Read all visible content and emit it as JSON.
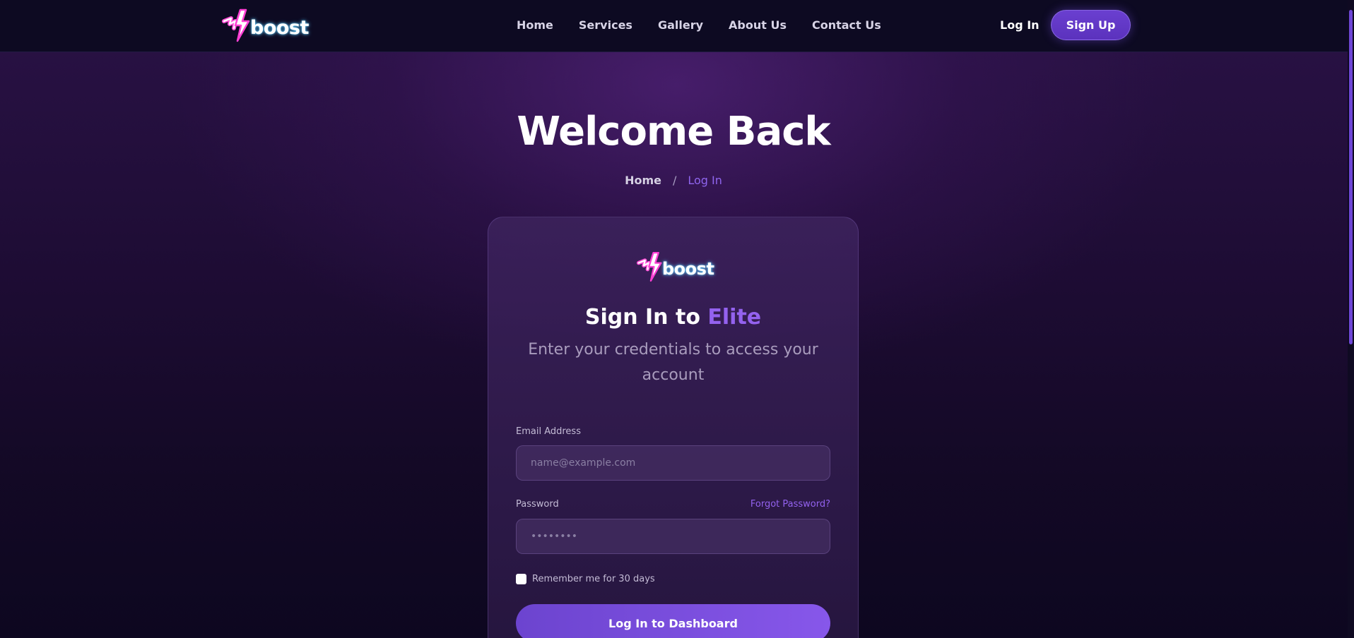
{
  "brand": {
    "name": "boost"
  },
  "nav": {
    "links": [
      "Home",
      "Services",
      "Gallery",
      "About Us",
      "Contact Us"
    ],
    "login_label": "Log In",
    "signup_label": "Sign Up"
  },
  "hero": {
    "title": "Welcome Back",
    "breadcrumb": {
      "home": "Home",
      "separator": "/",
      "current": "Log In"
    }
  },
  "card": {
    "title_prefix": "Sign In to",
    "title_accent": "Elite",
    "subtitle": "Enter your credentials to access your account",
    "email": {
      "label": "Email Address",
      "placeholder": "name@example.com",
      "value": ""
    },
    "password": {
      "label": "Password",
      "placeholder": "••••••••",
      "value": ""
    },
    "forgot_password_label": "Forgot Password?",
    "remember_label": "Remember me for 30 days",
    "remember_checked": false,
    "submit_label": "Log In to Dashboard"
  },
  "colors": {
    "background_top": "#2a1246",
    "background_bottom": "#0d0720",
    "navbar": "#0d0a22",
    "accent": "#9462ef",
    "button": "#6c44cf"
  },
  "icons": {
    "logo_mark": "lightning-bolt-icon",
    "checkbox": "checkbox-unchecked-icon"
  }
}
